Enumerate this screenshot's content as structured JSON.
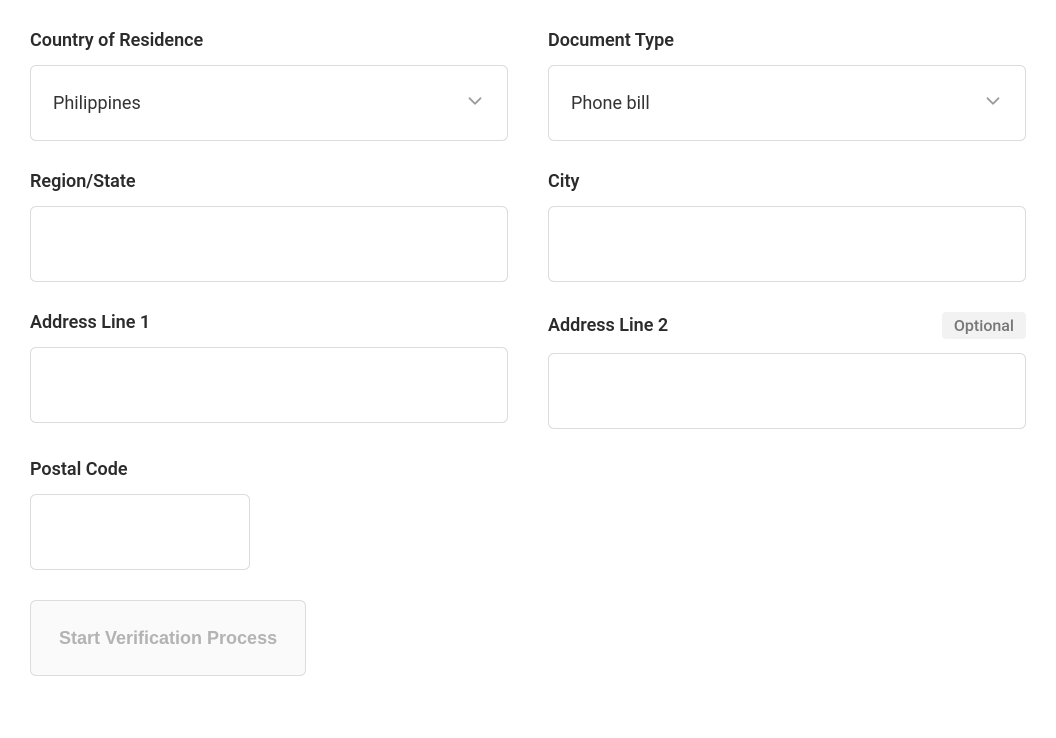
{
  "form": {
    "country": {
      "label": "Country of Residence",
      "value": "Philippines"
    },
    "documentType": {
      "label": "Document Type",
      "value": "Phone bill"
    },
    "region": {
      "label": "Region/State",
      "value": ""
    },
    "city": {
      "label": "City",
      "value": ""
    },
    "address1": {
      "label": "Address Line 1",
      "value": ""
    },
    "address2": {
      "label": "Address Line 2",
      "value": "",
      "optionalBadge": "Optional"
    },
    "postalCode": {
      "label": "Postal Code",
      "value": ""
    },
    "submit": {
      "label": "Start Verification Process"
    }
  }
}
